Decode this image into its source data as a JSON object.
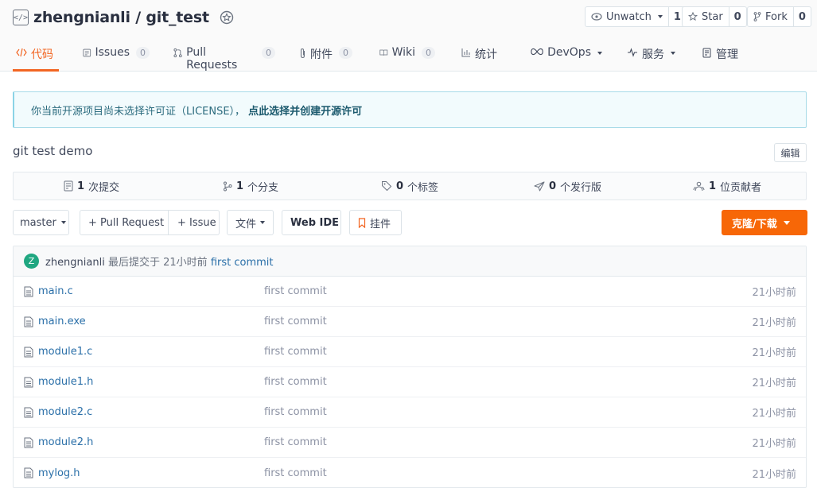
{
  "repo": {
    "owner": "zhengnianli",
    "separator": "/",
    "name": "git_test"
  },
  "actions": {
    "watch": {
      "label": "Unwatch",
      "count": "1"
    },
    "star": {
      "label": "Star",
      "count": "0"
    },
    "fork": {
      "label": "Fork",
      "count": "0"
    }
  },
  "tabs": [
    {
      "label": "代码",
      "count": null,
      "active": true
    },
    {
      "label": "Issues",
      "count": "0"
    },
    {
      "label": "Pull Requests",
      "count": "0"
    },
    {
      "label": "附件",
      "count": "0"
    },
    {
      "label": "Wiki",
      "count": "0"
    },
    {
      "label": "统计",
      "count": null
    },
    {
      "label": "DevOps",
      "count": null
    },
    {
      "label": "服务",
      "count": null
    },
    {
      "label": "管理",
      "count": null
    }
  ],
  "license": {
    "text": "你当前开源项目尚未选择许可证（LICENSE），",
    "link": "点此选择并创建开源许可"
  },
  "description": "git test demo",
  "edit_label": "编辑",
  "stats": [
    {
      "num": "1",
      "label": "次提交"
    },
    {
      "num": "1",
      "label": "个分支"
    },
    {
      "num": "0",
      "label": "个标签"
    },
    {
      "num": "0",
      "label": "个发行版"
    },
    {
      "num": "1",
      "label": "位贡献者"
    }
  ],
  "toolbar": {
    "branch": "master",
    "pull_request": "+ Pull Request",
    "issue": "+ Issue",
    "file": "文件",
    "web_ide": "Web IDE",
    "widget": "挂件",
    "clone": "克隆/下载"
  },
  "last_commit": {
    "avatar": "Z",
    "author": "zhengnianli",
    "text": "最后提交于",
    "time": "21小时前",
    "message": "first commit"
  },
  "files": [
    {
      "name": "main.c",
      "message": "first commit",
      "time": "21小时前"
    },
    {
      "name": "main.exe",
      "message": "first commit",
      "time": "21小时前"
    },
    {
      "name": "module1.c",
      "message": "first commit",
      "time": "21小时前"
    },
    {
      "name": "module1.h",
      "message": "first commit",
      "time": "21小时前"
    },
    {
      "name": "module2.c",
      "message": "first commit",
      "time": "21小时前"
    },
    {
      "name": "module2.h",
      "message": "first commit",
      "time": "21小时前"
    },
    {
      "name": "mylog.h",
      "message": "first commit",
      "time": "21小时前"
    }
  ]
}
